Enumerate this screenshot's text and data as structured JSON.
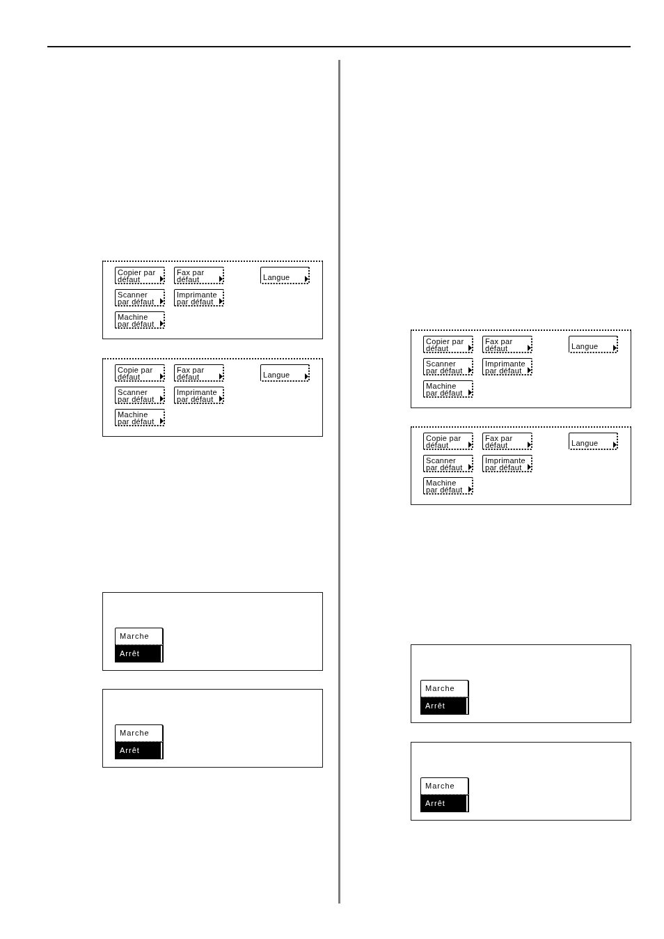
{
  "columns": [
    {
      "panels": [
        {
          "kind": "menu",
          "buttons": [
            {
              "lines": [
                "Copier par",
                "défaut"
              ]
            },
            {
              "lines": [
                "Fax par",
                "défaut"
              ]
            },
            {
              "lines": [
                "Scanner",
                "par défaut"
              ]
            },
            {
              "lines": [
                "Imprimante",
                "par défaut"
              ]
            },
            {
              "lines": [
                "Machine",
                "par défaut"
              ]
            }
          ],
          "side_button": {
            "lines": [
              "Langue"
            ]
          }
        },
        {
          "kind": "menu",
          "buttons": [
            {
              "lines": [
                "Copie par",
                "défaut"
              ]
            },
            {
              "lines": [
                "Fax par",
                "défaut"
              ]
            },
            {
              "lines": [
                "Scanner",
                "par défaut"
              ]
            },
            {
              "lines": [
                "Imprimante",
                "par défaut"
              ]
            },
            {
              "lines": [
                "Machine",
                "par défaut"
              ]
            }
          ],
          "side_button": {
            "lines": [
              "Langue"
            ]
          }
        },
        {
          "kind": "toggle",
          "options": [
            {
              "label": "Marche",
              "selected": false
            },
            {
              "label": "Arrêt",
              "selected": true
            }
          ]
        },
        {
          "kind": "toggle",
          "options": [
            {
              "label": "Marche",
              "selected": false
            },
            {
              "label": "Arrêt",
              "selected": true
            }
          ]
        }
      ]
    },
    {
      "panels": [
        {
          "kind": "menu",
          "buttons": [
            {
              "lines": [
                "Copier par",
                "défaut"
              ]
            },
            {
              "lines": [
                "Fax par",
                "défaut"
              ]
            },
            {
              "lines": [
                "Scanner",
                "par défaut"
              ]
            },
            {
              "lines": [
                "Imprimante",
                "par défaut"
              ]
            },
            {
              "lines": [
                "Machine",
                "par défaut"
              ]
            }
          ],
          "side_button": {
            "lines": [
              "Langue"
            ]
          }
        },
        {
          "kind": "menu",
          "buttons": [
            {
              "lines": [
                "Copie par",
                "défaut"
              ]
            },
            {
              "lines": [
                "Fax par",
                "défaut"
              ]
            },
            {
              "lines": [
                "Scanner",
                "par défaut"
              ]
            },
            {
              "lines": [
                "Imprimante",
                "par défaut"
              ]
            },
            {
              "lines": [
                "Machine",
                "par défaut"
              ]
            }
          ],
          "side_button": {
            "lines": [
              "Langue"
            ]
          }
        },
        {
          "kind": "toggle",
          "options": [
            {
              "label": "Marche",
              "selected": false
            },
            {
              "label": "Arrêt",
              "selected": true
            }
          ]
        },
        {
          "kind": "toggle",
          "options": [
            {
              "label": "Marche",
              "selected": false
            },
            {
              "label": "Arrêt",
              "selected": true
            }
          ]
        }
      ]
    }
  ]
}
